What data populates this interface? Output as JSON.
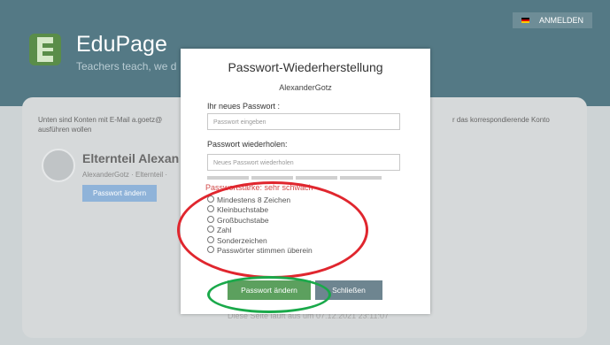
{
  "header": {
    "brand": "EduPage",
    "tagline": "Teachers teach, we d",
    "login_label": "ANMELDEN",
    "flag_icon": "german-flag-icon"
  },
  "background": {
    "info_text": "Unten sind Konten mit E-Mail a.goetz@",
    "info_text_2": "ausführen wollen",
    "info_text_right": "r das korrespondierende Konto",
    "parent_name": "Elternteil Alexan",
    "parent_sub": "AlexanderGotz · Elternteil ·",
    "change_password_label": "Passwort ändern",
    "footer_text": "Diese Seite läuft aus um 07.12.2021 23:11:07"
  },
  "modal": {
    "title": "Passwort-Wiederherstellung",
    "username": "AlexanderGotz",
    "new_password_label": "Ihr neues Passwort :",
    "new_password_placeholder": "Passwort eingeben",
    "repeat_password_label": "Passwort wiederholen:",
    "repeat_password_placeholder": "Neues Passwort wiederholen",
    "strength_text": "Passwortstärke: sehr schwach",
    "requirements": [
      "Mindestens 8 Zeichen",
      "Kleinbuchstabe",
      "Großbuchstabe",
      "Zahl",
      "Sonderzeichen",
      "Passwörter stimmen überein"
    ],
    "change_button": "Passwort ändern",
    "close_button": "Schließen"
  },
  "annotations": {
    "red_ellipse_color": "#e0262e",
    "green_ellipse_color": "#1aa94a"
  }
}
